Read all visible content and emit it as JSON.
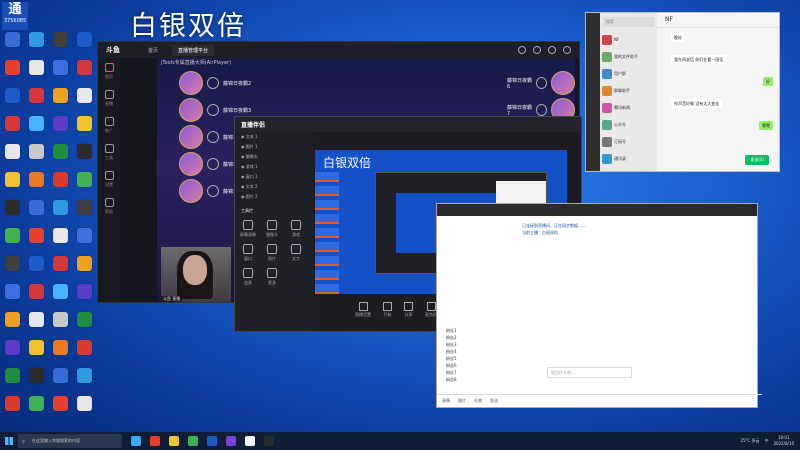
{
  "overlay": {
    "title": "白银双倍"
  },
  "top_badge": {
    "big": "通",
    "sub": "3756085"
  },
  "desktop_icons": [
    {
      "label": "",
      "color": "#3a6bd6"
    },
    {
      "label": "",
      "color": "#e8402e"
    },
    {
      "label": "",
      "color": "#1d5bc8"
    },
    {
      "label": "",
      "color": "#d8373a"
    },
    {
      "label": "",
      "color": "#e7e7ec"
    },
    {
      "label": "",
      "color": "#f2c230"
    },
    {
      "label": "",
      "color": "#2c2c2c"
    },
    {
      "label": "",
      "color": "#40b050"
    },
    {
      "label": "",
      "color": "#3f3f3f"
    },
    {
      "label": "",
      "color": "#3d6fe0"
    },
    {
      "label": "",
      "color": "#f0a020"
    },
    {
      "label": "",
      "color": "#5a3cc8"
    },
    {
      "label": "",
      "color": "#1d8e3e"
    },
    {
      "label": "",
      "color": "#d93a2d"
    },
    {
      "label": "",
      "color": "#2f9ae0"
    },
    {
      "label": "",
      "color": "#e8e8e8"
    },
    {
      "label": "",
      "color": "#d8373a"
    },
    {
      "label": "",
      "color": "#4ab2ff"
    },
    {
      "label": "",
      "color": "#c9c9c9"
    },
    {
      "label": "",
      "color": "#ee7722"
    }
  ],
  "main_window": {
    "logo": "斗鱼",
    "tabs": [
      "首页",
      "直播管理平台"
    ],
    "player_title": "jTools专属直播大师(AirPlayer)",
    "sidebar": [
      "首页",
      "直播",
      "推广",
      "工具",
      "设置",
      "帮助"
    ],
    "hero_rows": [
      {
        "label": "藤锦日夜霸2"
      },
      {
        "label": "藤锦日夜霸3"
      },
      {
        "label": "藤锦日夜霸4"
      },
      {
        "label": "藤锦日夜霸5"
      },
      {
        "label": "藤锦日夜霸6"
      }
    ],
    "right_hero_rows": [
      {
        "label": "藤锦日夜霸6"
      },
      {
        "label": "藤锦日夜霸7"
      },
      {
        "label": "藤锦日夜霸8"
      },
      {
        "label": "藤锦日夜霸9"
      },
      {
        "label": "藤锦日夜霸10"
      }
    ],
    "cam_label": "斗鱼 直播"
  },
  "obs_window": {
    "logo": "直播伴侣",
    "scene_rows": [
      "文本 1",
      "图片 1",
      "摄像头",
      "游戏 1",
      "窗口 1",
      "文本 2",
      "图片 2"
    ],
    "tool_label": "工具栏",
    "tool_buttons": [
      "屏幕录像",
      "摄像头",
      "游戏",
      "窗口",
      "图片",
      "文字",
      "连麦",
      "更多"
    ],
    "bottom_buttons": [
      "直播设置",
      "开始",
      "分享",
      "麦克风",
      "扬声器",
      "美颜"
    ],
    "start_label": "开始直播"
  },
  "wechat": {
    "search": "搜索",
    "chat_title": "NF",
    "contacts": [
      {
        "name": "NF"
      },
      {
        "name": "我的文件助手"
      },
      {
        "name": "用户群"
      },
      {
        "name": "群聊助手"
      },
      {
        "name": "腾讯新闻"
      },
      {
        "name": "公众号"
      },
      {
        "name": "订阅号"
      },
      {
        "name": "通讯录"
      }
    ],
    "messages": [
      {
        "text": "晚好",
        "me": false
      },
      {
        "text": "我在再说话 你们在看一段话",
        "me": false
      },
      {
        "text": "好",
        "me": true
      },
      {
        "text": "你声音好像 没有太大变化",
        "me": false
      },
      {
        "text": "嗯嗯",
        "me": true
      }
    ],
    "send_label": "发送(S)"
  },
  "chat_client": {
    "lines": [
      "已连接到直播间，正在同步数据……",
      "当前主播：白银双倍"
    ],
    "list": [
      "粉丝1",
      "粉丝2",
      "粉丝3",
      "粉丝4",
      "粉丝5",
      "粉丝6",
      "粉丝7",
      "粉丝8"
    ],
    "input_placeholder": "说点什么吧...",
    "bottom": [
      "表情",
      "图片",
      "礼物",
      "发送"
    ]
  },
  "taskbar": {
    "search_placeholder": "在这里输入你要搜索的内容",
    "temp": "25°C 多云",
    "time": "19:01",
    "date": "2022/8/10",
    "lang": "中"
  }
}
